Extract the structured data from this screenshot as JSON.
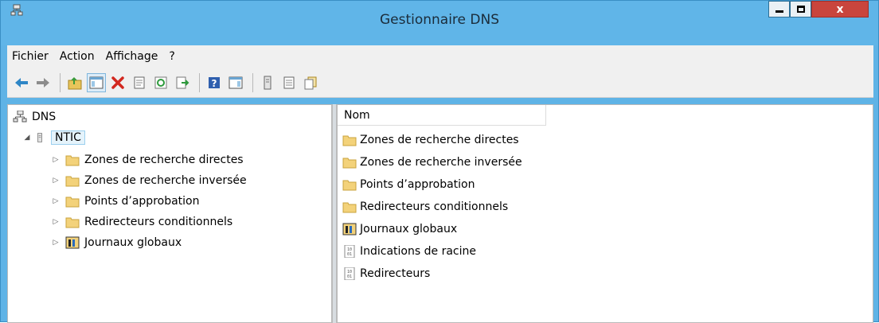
{
  "window": {
    "title": "Gestionnaire DNS",
    "controls": {
      "minimize": "▁",
      "maximize": "□",
      "close": "x"
    }
  },
  "menu": [
    "Fichier",
    "Action",
    "Affichage",
    "?"
  ],
  "toolbar": {
    "icons": [
      "back-arrow-icon",
      "forward-arrow-icon",
      "up-folder-icon",
      "show-hide-tree-icon",
      "delete-icon",
      "properties-icon",
      "refresh-icon",
      "export-list-icon",
      "help-icon",
      "show-hide-action-pane-icon",
      "server-icon",
      "list-icon",
      "copy-icon"
    ]
  },
  "tree": {
    "root": "DNS",
    "server": "NTIC",
    "children": [
      {
        "label": "Zones de recherche directes",
        "icon": "folder-icon"
      },
      {
        "label": "Zones de recherche inversée",
        "icon": "folder-icon"
      },
      {
        "label": "Points d’approbation",
        "icon": "folder-icon"
      },
      {
        "label": "Redirecteurs conditionnels",
        "icon": "folder-icon"
      },
      {
        "label": "Journaux globaux",
        "icon": "log-viewer-icon"
      }
    ]
  },
  "list": {
    "column": "Nom",
    "items": [
      {
        "label": "Zones de recherche directes",
        "icon": "folder-icon"
      },
      {
        "label": "Zones de recherche inversée",
        "icon": "folder-icon"
      },
      {
        "label": "Points d’approbation",
        "icon": "folder-icon"
      },
      {
        "label": "Redirecteurs conditionnels",
        "icon": "folder-icon"
      },
      {
        "label": "Journaux globaux",
        "icon": "log-viewer-icon"
      },
      {
        "label": "Indications de racine",
        "icon": "binary-file-icon"
      },
      {
        "label": "Redirecteurs",
        "icon": "binary-file-icon"
      }
    ]
  },
  "colors": {
    "titlebar": "#60b5e8",
    "close": "#c9453d",
    "selection": "#e5f3fb",
    "folder": "#f3d27a"
  }
}
